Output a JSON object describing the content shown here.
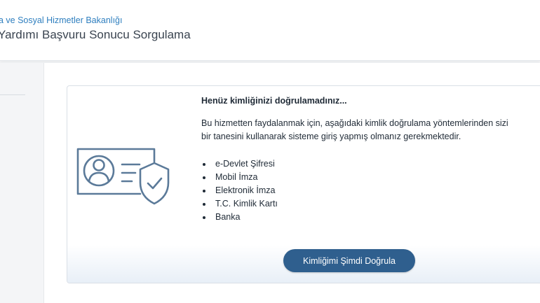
{
  "header": {
    "ministry": "a ve Sosyal Hizmetler Bakanlığı",
    "title": "Yardımı Başvuru Sonucu Sorgulama"
  },
  "card": {
    "title": "Henüz kimliğinizi doğrulamadınız...",
    "description_line1": "Bu hizmetten faydalanmak için, aşağıdaki kimlik doğrulama yöntemlerinden sizi",
    "description_line2": "bir tanesini kullanarak sisteme giriş yapmış olmanız gerekmektedir.",
    "methods": [
      "e-Devlet Şifresi",
      "Mobil İmza",
      "Elektronik İmza",
      "T.C. Kimlik Kartı",
      "Banka"
    ],
    "icon": "id-card-shield-icon",
    "button_label": "Kimliğimi Şimdi Doğrula"
  },
  "colors": {
    "accent": "#2f5f8e",
    "link": "#2f7fbf",
    "icon_stroke": "#5b7a99"
  }
}
